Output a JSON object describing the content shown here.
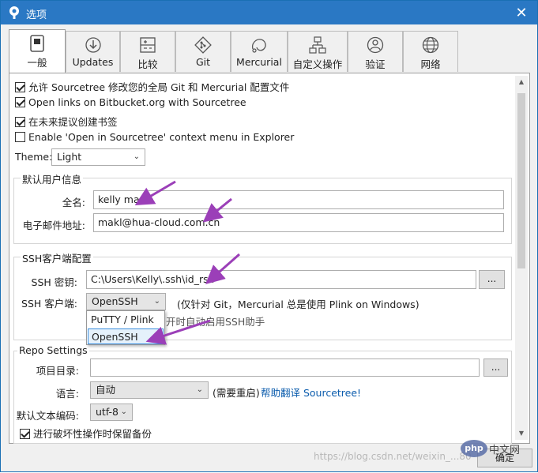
{
  "window": {
    "title": "选项",
    "close_glyph": "✕"
  },
  "tabs": [
    {
      "label": "一般",
      "icon": "toggle-switch-icon",
      "active": true
    },
    {
      "label": "Updates",
      "icon": "download-icon"
    },
    {
      "label": "比较",
      "icon": "diff-plus-minus-icon"
    },
    {
      "label": "Git",
      "icon": "git-icon"
    },
    {
      "label": "Mercurial",
      "icon": "mercurial-icon"
    },
    {
      "label": "自定义操作",
      "icon": "custom-actions-icon"
    },
    {
      "label": "验证",
      "icon": "user-icon"
    },
    {
      "label": "网络",
      "icon": "globe-icon"
    }
  ],
  "general": {
    "options": [
      {
        "label": "允许 Sourcetree 修改您的全局 Git 和 Mercurial 配置文件",
        "checked": true
      },
      {
        "label": "Open links on Bitbucket.org with Sourcetree",
        "checked": true
      },
      {
        "label": "在未来提议创建书签",
        "checked": true
      },
      {
        "label": "Enable 'Open in Sourcetree' context menu in Explorer",
        "checked": false
      }
    ],
    "theme_label": "Theme:",
    "theme_value": "Light"
  },
  "user_info": {
    "title": "默认用户信息",
    "fullname_label": "全名:",
    "fullname_value": "kelly ma",
    "email_label": "电子邮件地址:",
    "email_value": "makl@hua-cloud.com.cn"
  },
  "ssh": {
    "title": "SSH客户端配置",
    "key_label": "SSH 密钥:",
    "key_value": "C:\\Users\\Kelly\\.ssh\\id_rsa",
    "browse_label": "...",
    "client_label": "SSH 客户端:",
    "client_value": "OpenSSH",
    "client_note": "(仅针对 Git，Mercurial 总是使用 Plink on Windows)",
    "agent_label_partial": "开时自动启用SSH助手",
    "dropdown_options": [
      "PuTTY / Plink",
      "OpenSSH"
    ]
  },
  "repo": {
    "title": "Repo Settings",
    "project_dir_label": "项目目录:",
    "project_dir_value": "",
    "browse_label": "...",
    "language_label": "语言:",
    "language_value": "自动",
    "restart_note": "(需要重启)",
    "translate_link": "帮助翻译 Sourcetree!",
    "encoding_label": "默认文本编码:",
    "encoding_value": "utf-8",
    "backup_label": "进行破坏性操作时保留备份",
    "backup_checked": true
  },
  "footer": {
    "ok_label": "确定",
    "watermark": "https://blog.csdn.net/weixin_...80",
    "php_logo": "php",
    "php_text": "中文网"
  },
  "colors": {
    "titlebar": "#2a78c4",
    "annotation_arrow": "#9b3fb8",
    "link": "#0b5cad"
  }
}
